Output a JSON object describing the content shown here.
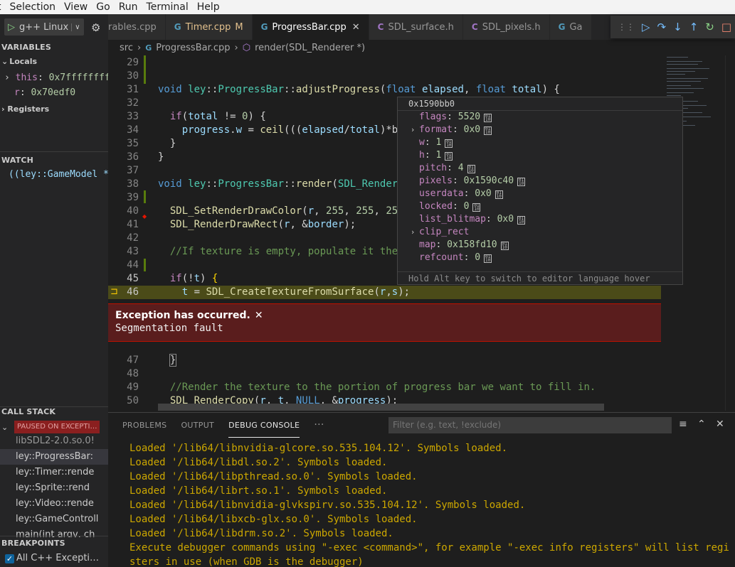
{
  "menubar": [
    "t",
    "Selection",
    "View",
    "Go",
    "Run",
    "Terminal",
    "Help"
  ],
  "run_config": {
    "label": "g++ Linux"
  },
  "variables": {
    "title": "VARIABLES",
    "locals_label": "Locals",
    "locals": [
      {
        "name": "this",
        "value": "0x7ffffffff…"
      },
      {
        "name": "r",
        "value": "0x70edf0"
      }
    ],
    "registers_label": "Registers"
  },
  "watch": {
    "title": "WATCH",
    "items": [
      "((ley::GameModel *"
    ]
  },
  "call_stack": {
    "title": "CALL STACK",
    "badge": "PAUSED ON EXCEPTI…",
    "frames": [
      "libSDL2-2.0.so.0!",
      "ley::ProgressBar:",
      "ley::Timer::rende",
      "ley::Sprite::rend",
      "ley::Video::rende",
      "ley::GameControll",
      "main(int argv, ch"
    ]
  },
  "breakpoints": {
    "title": "BREAKPOINTS",
    "items": [
      "All C++ Excepti…"
    ]
  },
  "tabs": [
    {
      "name": "rables.cpp",
      "type": "cpp"
    },
    {
      "name": "Timer.cpp",
      "type": "cpp",
      "modified": "M"
    },
    {
      "name": "ProgressBar.cpp",
      "type": "cpp",
      "active": true
    },
    {
      "name": "SDL_surface.h",
      "type": "h"
    },
    {
      "name": "SDL_pixels.h",
      "type": "h"
    },
    {
      "name": "Ga",
      "type": "cpp"
    }
  ],
  "breadcrumb": {
    "folder": "src",
    "file": "ProgressBar.cpp",
    "symbol": "render(SDL_Renderer *)"
  },
  "exception": {
    "title": "Exception has occurred.",
    "message": "Segmentation fault"
  },
  "hover": {
    "title": "0x1590bb0",
    "rows": [
      {
        "key": "flags",
        "value": "5520"
      },
      {
        "key": "format",
        "value": "0x0"
      },
      {
        "key": "w",
        "value": "1"
      },
      {
        "key": "h",
        "value": "1"
      },
      {
        "key": "pitch",
        "value": "4"
      },
      {
        "key": "pixels",
        "value": "0x1590c40"
      },
      {
        "key": "userdata",
        "value": "0x0"
      },
      {
        "key": "locked",
        "value": "0"
      },
      {
        "key": "list_blitmap",
        "value": "0x0"
      },
      {
        "key": "clip_rect",
        "value": ""
      },
      {
        "key": "map",
        "value": "0x158fd10"
      },
      {
        "key": "refcount",
        "value": "0"
      }
    ],
    "footer": "Hold Alt key to switch to editor language hover"
  },
  "panel": {
    "tabs": [
      "PROBLEMS",
      "OUTPUT",
      "DEBUG CONSOLE"
    ],
    "filter_placeholder": "Filter (e.g. text, !exclude)",
    "console": [
      "Loaded '/lib64/libnvidia-glcore.so.535.104.12'. Symbols loaded.",
      "Loaded '/lib64/libdl.so.2'. Symbols loaded.",
      "Loaded '/lib64/libpthread.so.0'. Symbols loaded.",
      "Loaded '/lib64/librt.so.1'. Symbols loaded.",
      "Loaded '/lib64/libnvidia-glvkspirv.so.535.104.12'. Symbols loaded.",
      "Loaded '/lib64/libxcb-glx.so.0'. Symbols loaded.",
      "Loaded '/lib64/libdrm.so.2'. Symbols loaded.",
      "Execute debugger commands using \"-exec <command>\", for example \"-exec info registers\" will list regi",
      "sters in use (when GDB is the debugger)"
    ]
  },
  "colors": {
    "accent": "#0e639c",
    "exception_bg": "#5a1d1d",
    "console_text": "#cca700",
    "current_line": "#4b4b18"
  }
}
